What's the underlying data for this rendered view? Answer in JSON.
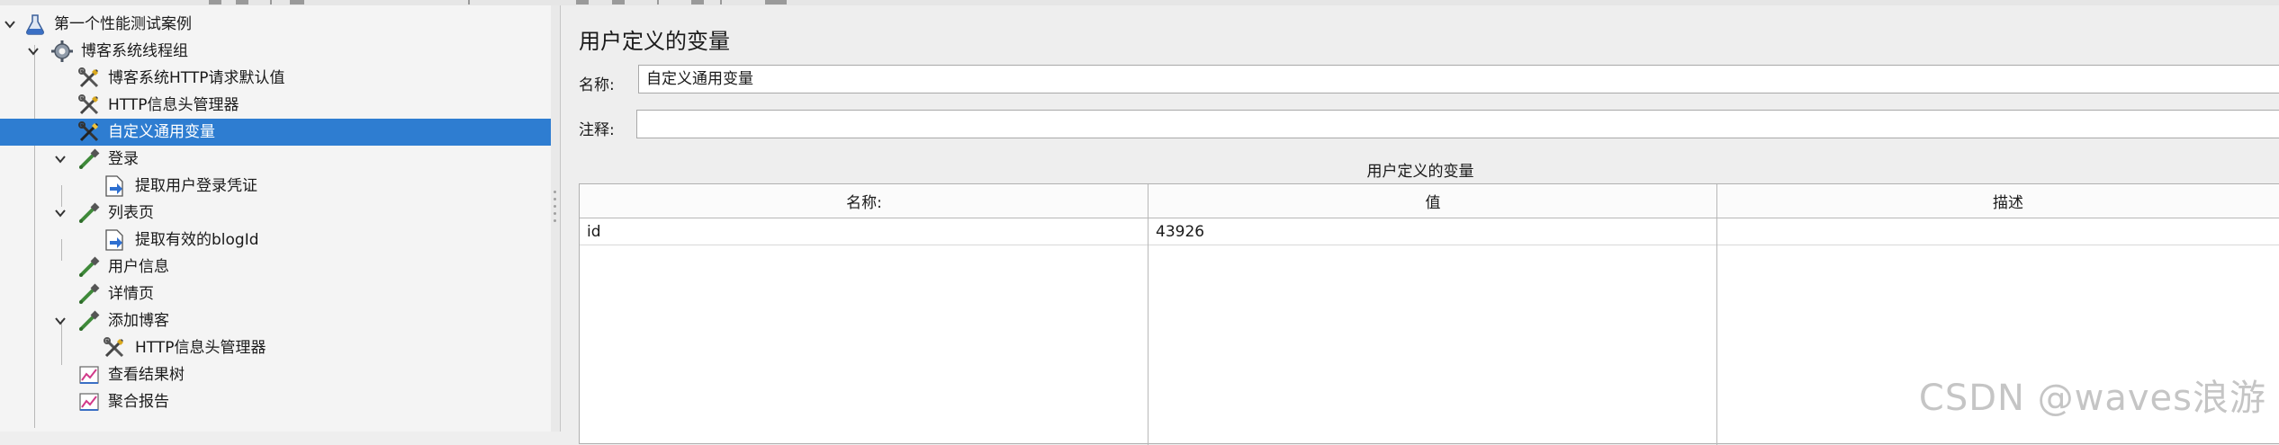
{
  "tree": {
    "items": [
      {
        "label": "第一个性能测试案例",
        "icon": "flask-icon",
        "expanded": true
      },
      {
        "label": "博客系统线程组",
        "icon": "gear-icon",
        "expanded": true
      },
      {
        "label": "博客系统HTTP请求默认值",
        "icon": "wrench-screwdriver-icon"
      },
      {
        "label": "HTTP信息头管理器",
        "icon": "wrench-screwdriver-icon"
      },
      {
        "label": "自定义通用变量",
        "icon": "wrench-screwdriver-icon",
        "selected": true
      },
      {
        "label": "登录",
        "icon": "pipette-icon",
        "expanded": true
      },
      {
        "label": "提取用户登录凭证",
        "icon": "postprocessor-icon"
      },
      {
        "label": "列表页",
        "icon": "pipette-icon",
        "expanded": true
      },
      {
        "label": "提取有效的blogId",
        "icon": "postprocessor-icon"
      },
      {
        "label": "用户信息",
        "icon": "pipette-icon"
      },
      {
        "label": "详情页",
        "icon": "pipette-icon"
      },
      {
        "label": "添加博客",
        "icon": "pipette-icon",
        "expanded": true
      },
      {
        "label": "HTTP信息头管理器",
        "icon": "wrench-screwdriver-icon"
      },
      {
        "label": "查看结果树",
        "icon": "chart-listener-icon"
      },
      {
        "label": "聚合报告",
        "icon": "chart-listener-icon"
      }
    ]
  },
  "panel": {
    "title": "用户定义的变量",
    "name_label": "名称:",
    "name_value": "自定义通用变量",
    "comment_label": "注释:",
    "comment_value": "",
    "table_caption": "用户定义的变量",
    "columns": [
      "名称:",
      "值",
      "描述"
    ],
    "rows": [
      {
        "name": "id",
        "value": "43926",
        "desc": ""
      }
    ]
  },
  "colors": {
    "selection": "#2e7dd1",
    "background": "#eeeeee"
  },
  "watermark": "CSDN @waves浪游"
}
